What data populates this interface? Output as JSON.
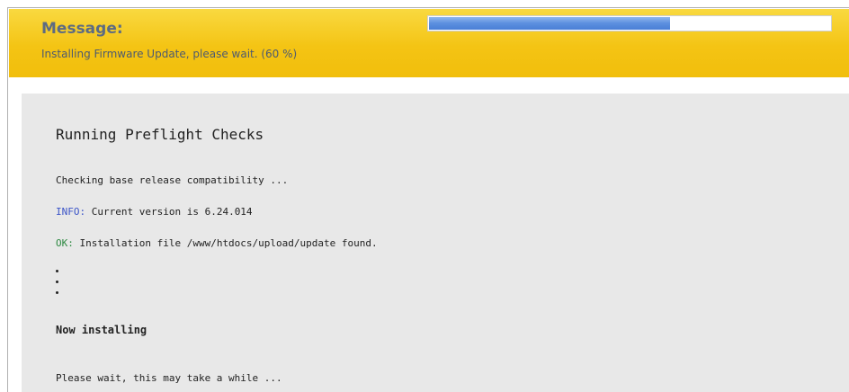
{
  "message": {
    "title": "Message:",
    "text": "Installing Firmware Update, please wait.  (60 %)",
    "progress_percent": 60
  },
  "log": {
    "heading": "Running Preflight Checks",
    "checking_line": "Checking base release compatibility ...",
    "info_tag": "INFO:",
    "info_text": " Current version is 6.24.014",
    "ok_tag": "OK:",
    "ok_text": " Installation file /www/htdocs/upload/update found.",
    "now_installing": "Now installing",
    "wait_line": "Please wait, this may take a while ..."
  },
  "colors": {
    "banner": "#f4c414",
    "progress_fill": "#5b8fdf",
    "info": "#3b54c8",
    "ok": "#2f8a43",
    "panel": "#e8e8e8"
  }
}
